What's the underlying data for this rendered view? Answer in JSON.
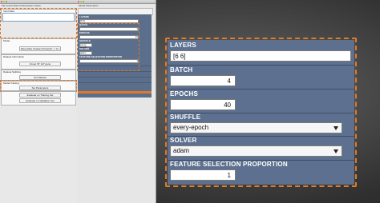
{
  "window1": {
    "title": "File Import Export Parameters Views",
    "sections": [
      {
        "label": "Input Data",
        "button": ""
      },
      {
        "label": "Model",
        "button": "Mean-Max Clusters-Proto(AC -> G.)"
      },
      {
        "label": "Dataset Information",
        "button": "Group ST 147 gene"
      },
      {
        "label": "Dataset Splitting",
        "button": "Set Dataset"
      },
      {
        "label": "Model Training",
        "button": "Set Parameters"
      }
    ],
    "actions": {
      "train": "Evaluate on Training Set",
      "validate": "Evaluate on Validation Set"
    }
  },
  "window2": {
    "title": "Model Parameters"
  },
  "panel": {
    "fields": [
      {
        "label": "LAYERS",
        "value": "[6 6]",
        "kind": "text"
      },
      {
        "label": "BATCH",
        "value": "4",
        "kind": "number"
      },
      {
        "label": "EPOCHS",
        "value": "40",
        "kind": "number"
      }
    ],
    "shuffle": {
      "label": "SHUFFLE",
      "value": "every-epoch"
    },
    "solver": {
      "label": "SOLVER",
      "value": "adam"
    },
    "feature_selection": {
      "label": "FEATURE SELECTION PROPORTION",
      "value": "1"
    }
  },
  "colors": {
    "panel_bg": "#5d708f",
    "highlight": "#e07a25"
  }
}
